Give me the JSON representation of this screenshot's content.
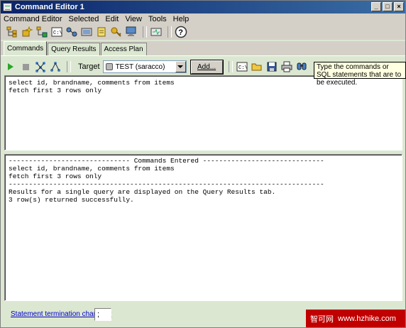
{
  "window": {
    "title": "Command Editor 1",
    "controls": [
      "_",
      "□",
      "×"
    ]
  },
  "menu": [
    "Command Editor",
    "Selected",
    "Edit",
    "View",
    "Tools",
    "Help"
  ],
  "toolbar_icons": [
    "object-tree-icon",
    "new-object-icon",
    "control-center-icon",
    "command-editor-icon",
    "replication-icon",
    "task-center-icon",
    "journal-icon",
    "license-icon",
    "development-center-icon",
    "tools-settings-icon",
    "help-icon"
  ],
  "tabs": [
    {
      "label": "Commands",
      "active": true
    },
    {
      "label": "Query Results",
      "active": false
    },
    {
      "label": "Access Plan",
      "active": false
    }
  ],
  "command_toolbar": {
    "target_label": "Target",
    "target_value": "TEST (saracco)",
    "add_button": "Add..."
  },
  "tooltip": "Type the commands or SQL statements that are to be executed.",
  "editor_text": "select id, brandname, comments from items\nfetch first 3 rows only",
  "output_text": "------------------------------ Commands Entered ------------------------------\nselect id, brandname, comments from items\nfetch first 3 rows only\n------------------------------------------------------------------------------\nResults for a single query are displayed on the Query Results tab.\n3 row(s) returned successfully.",
  "footer": {
    "termination_label": "Statement termination character",
    "termination_value": ";"
  },
  "watermark": {
    "text_cn": "智可网",
    "url": "www.hzhike.com"
  }
}
